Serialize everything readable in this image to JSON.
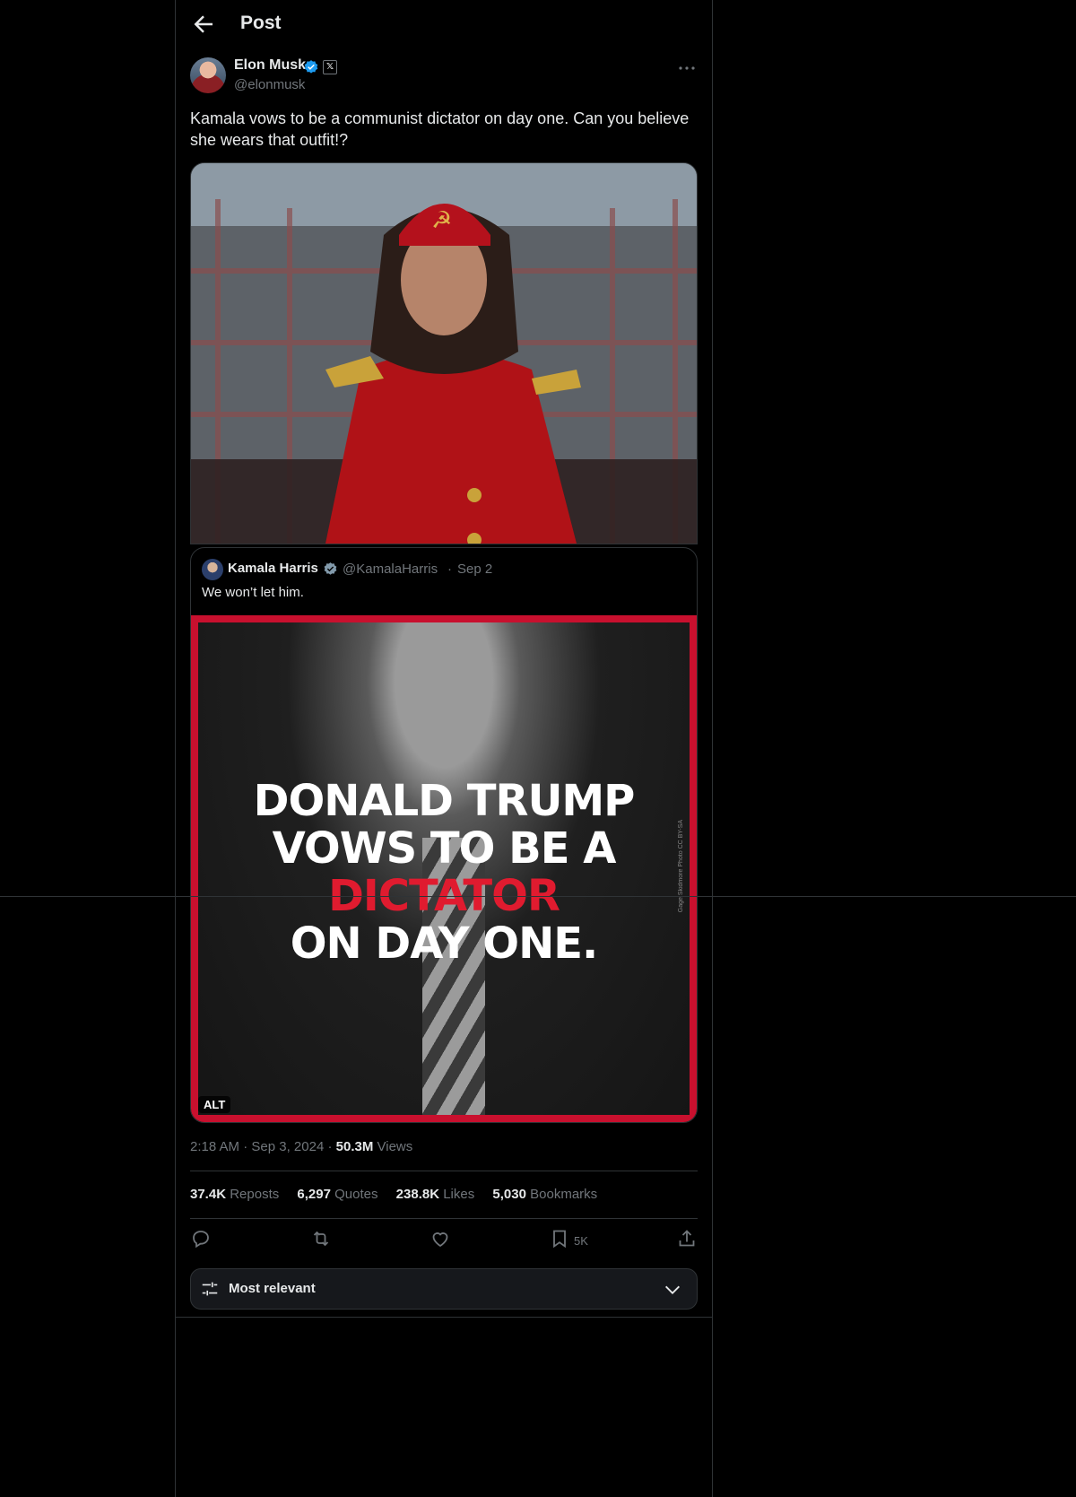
{
  "header": {
    "title": "Post"
  },
  "post": {
    "author_name": "Elon Musk",
    "author_handle": "@elonmusk",
    "badge_label": "𝕏",
    "text": "Kamala vows to be a communist dictator on day one. Can you believe she wears that outfit!?",
    "timestamp_time": "2:18 AM",
    "timestamp_date": "Sep 3, 2024",
    "views_count": "50.3M",
    "views_label": "Views"
  },
  "quote": {
    "author_name": "Kamala Harris",
    "author_handle": "@KamalaHarris",
    "separator": "·",
    "date": "Sep 2",
    "text": "We won’t let him.",
    "image": {
      "line1": "DONALD TRUMP",
      "line2": "VOWS TO BE A",
      "line3": "DICTATOR",
      "line4": "ON DAY ONE.",
      "credit": "Gage Skidmore Photo CC BY-SA",
      "alt_badge": "ALT"
    }
  },
  "stats": {
    "reposts_count": "37.4K",
    "reposts_label": "Reposts",
    "quotes_count": "6,297",
    "quotes_label": "Quotes",
    "likes_count": "238.8K",
    "likes_label": "Likes",
    "bookmarks_count": "5,030",
    "bookmarks_label": "Bookmarks"
  },
  "actions": {
    "bookmark_count": "5K"
  },
  "sort": {
    "label": "Most relevant"
  },
  "colors": {
    "accent": "#1d9bf0",
    "red": "#c8102e",
    "muted": "#71767b"
  }
}
